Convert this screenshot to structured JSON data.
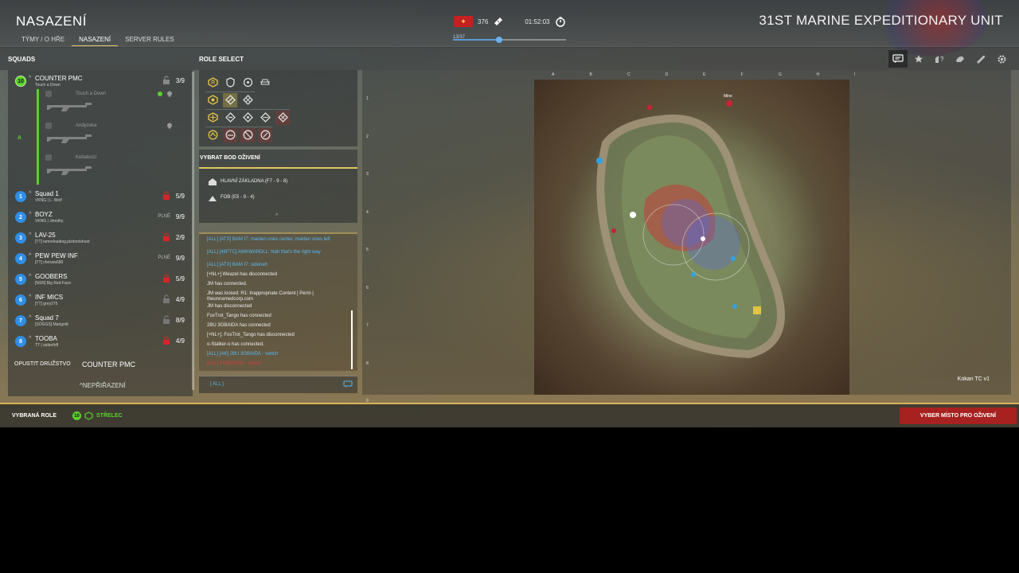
{
  "header": {
    "title": "NASAZENÍ",
    "unit_name": "31ST MARINE EXPEDITIONARY UNIT",
    "tabs": [
      {
        "label": "TÝMY / O HŘE",
        "active": false
      },
      {
        "label": "NASAZENÍ",
        "active": true
      },
      {
        "label": "SERVER RULES",
        "active": false
      }
    ],
    "tickets": "376",
    "time": "01:52:03",
    "progress_label": "13/37",
    "progress_fraction": 0.41
  },
  "colors": {
    "accent_gold": "#d7b458",
    "own_squad_green": "#5ad12b",
    "squad_blue": "#2f8ee6",
    "lock_red": "#d3262a",
    "spawn_button": "#a82121",
    "chat_blue": "#58b9f0",
    "chat_red": "#d64040"
  },
  "labels": {
    "squads": "SQUADS",
    "role_select": "ROLE SELECT",
    "spawn_header": "VYBRAT BOD OŽIVENÍ",
    "leave_squad": "OPUSTIT DRUŽSTVO",
    "current_squad": "COUNTER PMC",
    "unassigned": "NEPŘIŘAZENÍ",
    "selected_role": "VYBRANÁ ROLE",
    "selected_role_squad": "10",
    "selected_role_name": "STŘELEC",
    "spawn_button": "VYBER MÍSTO PRO OŽIVENÍ",
    "chat_channel": "[ ALL ]:",
    "map_name": "Kokan TC v1"
  },
  "own_squad": {
    "number": "10",
    "name": "COUNTER PMC",
    "sub": "Touch a Down",
    "count": "3/9",
    "leader_mark": "A",
    "members": [
      {
        "name": "Touch a Down"
      },
      {
        "name": "Andyzeka"
      },
      {
        "name": "Kebabcizi"
      }
    ]
  },
  "squads": [
    {
      "number": "1",
      "name": "Squad 1",
      "sub": "VKNG | L. Wolf",
      "count": "5/9",
      "status": "locked"
    },
    {
      "number": "2",
      "name": "BOYZ",
      "sub": "VKNG | Jimothy",
      "count": "9/9",
      "status": "full",
      "status_text": "PLNÉ"
    },
    {
      "number": "3",
      "name": "LAV-25",
      "sub": "[TT] iamreloading.plzdontshoot",
      "count": "2/9",
      "status": "locked"
    },
    {
      "number": "4",
      "name": "PEW PEW INF",
      "sub": "[TT] chrisws689",
      "count": "9/9",
      "status": "full",
      "status_text": "PLNÉ"
    },
    {
      "number": "5",
      "name": "GOOBERS",
      "sub": "[NSR] Big Red Face",
      "count": "5/9",
      "status": "locked"
    },
    {
      "number": "6",
      "name": "INF MICS",
      "sub": "[TT] grey275",
      "count": "4/9",
      "status": "open"
    },
    {
      "number": "7",
      "name": "Squad 7",
      "sub": "[SOGGS] Marigold",
      "count": "8/9",
      "status": "open"
    },
    {
      "number": "8",
      "name": "TOOBA",
      "sub": "TT | aidanfoff",
      "count": "4/9",
      "status": "locked"
    }
  ],
  "roles": {
    "rows": [
      [
        "squad-leader-icon",
        "medic-shield-icon",
        "driver-wheel-icon",
        "crewman-icon"
      ],
      [
        "rifleman-icon",
        "grenadier-icon",
        "automatic-rifleman-icon"
      ],
      [
        "marksman-icon",
        "lat-icon",
        "hat-icon",
        "engineer-icon",
        "sapper-icon"
      ],
      [
        "pilot-icon",
        "scout-icon",
        "restricted-icon",
        "sniper-icon"
      ]
    ]
  },
  "spawns": [
    {
      "label": "HLAVNÍ ZÁKLADNA (F7 - 9 - 8)",
      "icon": "main-base-icon"
    },
    {
      "label": "FOB (E5 - 9 - 4)",
      "icon": "fob-icon"
    }
  ],
  "chat": [
    {
      "text": "[ALL] [ATX] BAM I7: maiden ones center, maiden ones left",
      "color": "blue"
    },
    {
      "text": "[ALL] [46FTC] AWKWARDLL: Nah that's the right way",
      "color": "blue"
    },
    {
      "text": "[ALL] [ATX] BAM I7: sidenah",
      "color": "blue"
    },
    {
      "text": "[+NL+] Weazel has disconnected",
      "color": "white"
    },
    {
      "text": "JM has connected.",
      "color": "white"
    },
    {
      "text": "JM was kicked: R1: Inappropriate Content | Perm | theunnamedcorp.com",
      "color": "white"
    },
    {
      "text": "JM has disconnected",
      "color": "white"
    },
    {
      "text": "FoxTrot_Tango has connected",
      "color": "white"
    },
    {
      "text": "2BU 3OBAIDA has connected",
      "color": "white"
    },
    {
      "text": "[+NL+]. FoxTrot_Tango has disconnected",
      "color": "white"
    },
    {
      "text": "o-Stalker-o has connected.",
      "color": "white"
    },
    {
      "text": "[ALL] [AK] 2BU 3OBAIDA : switch",
      "color": "blue"
    },
    {
      "text": "[ALL] KOBAIDG3 : switch",
      "color": "red"
    }
  ],
  "map": {
    "columns": [
      "A",
      "B",
      "C",
      "D",
      "E",
      "F",
      "G",
      "H",
      "I"
    ],
    "rows": [
      "1",
      "2",
      "3",
      "4",
      "5",
      "6",
      "7",
      "8",
      "9"
    ],
    "markers": [
      {
        "type": "enemy",
        "label": "Mine"
      },
      {
        "type": "friendly"
      }
    ]
  },
  "toolbar": [
    {
      "icon": "chat-icon",
      "active": true
    },
    {
      "icon": "star-icon",
      "active": false
    },
    {
      "icon": "help-icon",
      "active": false
    },
    {
      "icon": "hand-icon",
      "active": false
    },
    {
      "icon": "rocket-icon",
      "active": false
    },
    {
      "icon": "gear-icon",
      "active": false
    }
  ]
}
